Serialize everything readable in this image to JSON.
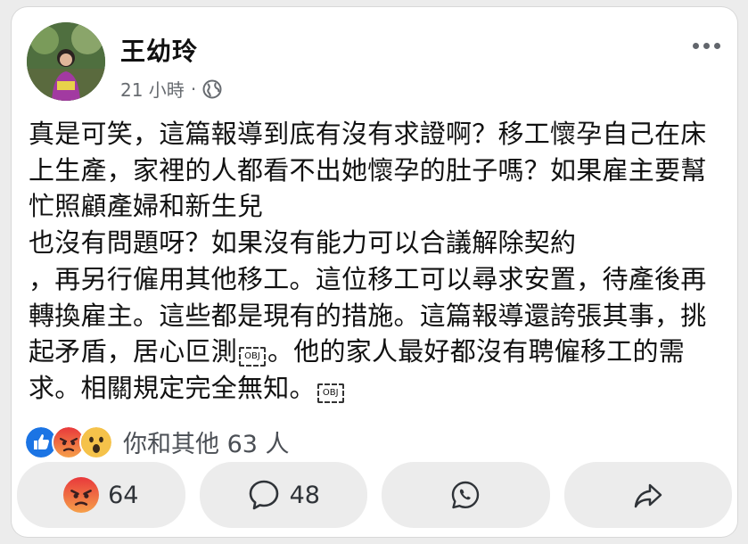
{
  "post": {
    "author": "王幼玲",
    "time": "21 小時",
    "separator": "·",
    "text_before_obj1": "真是可笑，這篇報導到底有沒有求證啊？移工懷孕自己在床上生產，家裡的人都看不出她懷孕的肚子嗎？如果雇主要幫忙照顧產婦和新生兒\n也沒有問題呀？如果沒有能力可以合議解除契約\n，再另行僱用其他移工。這位移工可以尋求安置，待產後再轉換雇主。這些都是現有的措施。這篇報導還誇張其事，挑起矛盾，居心叵測",
    "obj1": "OBJ",
    "text_middle": "。他的家人最好都沒有聘僱移工的需求。相關規定完全無知。",
    "obj2": "OBJ"
  },
  "reactions": {
    "icons": [
      "like-icon",
      "angry-icon",
      "wow-icon"
    ],
    "summary": "你和其他 63 人"
  },
  "actions": {
    "angry_count": "64",
    "comment_count": "48"
  },
  "colors": {
    "like": "#1b74e4",
    "angry": "#f0503f",
    "wow": "#f5c24a",
    "button_bg": "#ececec"
  }
}
